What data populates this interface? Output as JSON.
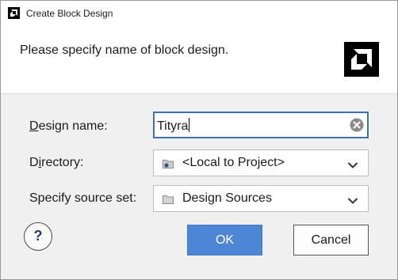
{
  "window": {
    "title": "Create Block Design",
    "app_icon": "amd-icon"
  },
  "header": {
    "message": "Please specify name of block design.",
    "logo": "amd-logo"
  },
  "form": {
    "design_name": {
      "label_first": "D",
      "label_rest": "esign name:",
      "value": "Tityra"
    },
    "directory": {
      "label_pre": "D",
      "label_underlined": "i",
      "label_post": "rectory:",
      "value": "<Local to Project>"
    },
    "source_set": {
      "label": "Specify source set:",
      "value": "Design Sources"
    }
  },
  "buttons": {
    "help": "?",
    "ok": "OK",
    "cancel": "Cancel"
  },
  "colors": {
    "accent": "#4e86d6",
    "focus_border": "#3b6fb6"
  }
}
